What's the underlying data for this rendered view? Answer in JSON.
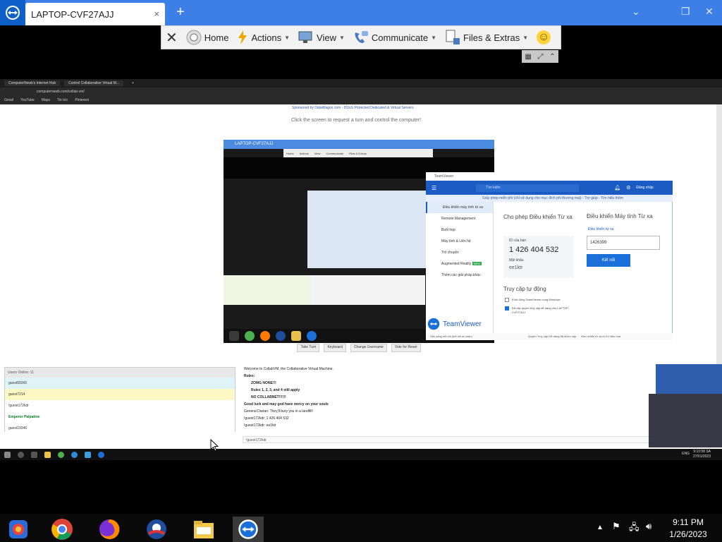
{
  "tabbar": {
    "tab_title": "LAPTOP-CVF27AJJ",
    "close_glyph": "×",
    "new_tab_glyph": "+",
    "window_controls": [
      "⌄",
      "❐",
      "✕"
    ]
  },
  "remote_toolbar": {
    "items": [
      {
        "label": "Home",
        "icon": "home-icon"
      },
      {
        "label": "Actions",
        "icon": "lightning-icon"
      },
      {
        "label": "View",
        "icon": "monitor-icon"
      },
      {
        "label": "Communicate",
        "icon": "phone-icon"
      },
      {
        "label": "Files & Extras",
        "icon": "files-icon"
      }
    ],
    "close_glyph": "✕",
    "emoji": "☺",
    "dropdown_caret": "▼",
    "mini_controls": [
      "▦",
      "⤢",
      "⌃"
    ]
  },
  "browser": {
    "tabs": [
      "ComputerNewb's Internet Hub",
      "Control Collaborative Virtual M...",
      "+"
    ],
    "url": "computernewb.com/collab-vm/",
    "bookmarks": [
      "Gmail",
      "YouTube",
      "Maps",
      "Tin tức",
      "Pinterest"
    ]
  },
  "page": {
    "sponsor": "Sponsored by DataWagon.com - DDoS Protected Dedicated & Virtual Servers",
    "click_text": "Click the screen to request a turn and control the computer!",
    "vm_title": "LAPTOP-CVF27AJJ",
    "vm_toolbar": [
      "Home",
      "Actions",
      "View",
      "Communicate",
      "Files & Extras"
    ],
    "buttons": [
      "Take Turn",
      "Keyboard",
      "Change Username",
      "Vote for Reset"
    ]
  },
  "teamviewer": {
    "title": "TeamViewer",
    "search_placeholder": "Tìm kiếm",
    "signin": "Đăng nhập",
    "note": "Giấy phép miễn phí (chỉ sử dụng cho mục đích phi thương mại) - Trợ giúp - Tìm hiểu thêm",
    "sidebar": [
      "Điều khiển máy tính từ xa",
      "Remote Management",
      "Buổi họp",
      "Máy tính & Liên hệ",
      "Trò chuyện",
      "Augmented Reality",
      "Thêm các giải pháp khác"
    ],
    "new_badge": "NEW",
    "allow_title": "Cho phép Điều khiển Từ xa",
    "id_label": "ID của bạn",
    "id_value": "1 426 404 532",
    "password_label": "Mật khẩu",
    "password_value": "ee1ktr",
    "remote_title": "Điều khiển Máy tính Từ xa",
    "remote_dropdown": "Điều khiển từ xa",
    "partner_id": "1426399",
    "connect": "Kết nối",
    "unattended_title": "Truy cập tự động",
    "check1": "Khởi động TeamViewer cùng Windows",
    "check2": "Đã cấp quyền truy cập dễ dàng cho LAPTOP-CVF27AJJ",
    "status_left": "Sẵn sàng kết nối (kết nối an toàn)",
    "status_mid": "Quyền Truy cập Dễ dàng đã được cấp",
    "status_right": "Điều khiển từ xa bị Vô hiệu hóa",
    "brand": "TeamViewer"
  },
  "chat": {
    "users_header": "Users Online: 11",
    "users": [
      {
        "name": "guest55000",
        "bg": "#dff4f8",
        "color": "#333"
      },
      {
        "name": "guest7214",
        "bg": "#fdf8c4",
        "color": "#333"
      },
      {
        "name": "!guest172kdr",
        "bg": "#fff",
        "color": "#333"
      },
      {
        "name": "Emperor Palpatine",
        "bg": "#fff",
        "color": "#0a7a22"
      },
      {
        "name": "guest19346",
        "bg": "#fff",
        "color": "#333"
      }
    ],
    "messages": [
      "Welcome to CollabVM, the Collaborative Virtual Machine.",
      "Rules:",
      "ZOMG NONE!!!",
      "Rules 1, 2, 3, and 4 still apply",
      "NO COLLABNET!!!!!!",
      "Good luck and may god have mercy on your souls",
      "General Darian: They'll bury you in a landfill!",
      "!guest172kdr: 1 426 404 532",
      "!guest172kdr: ee1ktr"
    ],
    "input_value": "!guest172kdr"
  },
  "remote_taskbar": {
    "time": "9:10:58 SA",
    "date": "27/01/2023",
    "lang": "ENG"
  },
  "local_taskbar": {
    "apps": [
      "photos-icon",
      "chrome-icon",
      "firefox-icon",
      "obama-icon",
      "file-explorer-icon",
      "teamviewer-icon"
    ],
    "time": "9:11 PM",
    "date": "1/26/2023"
  }
}
